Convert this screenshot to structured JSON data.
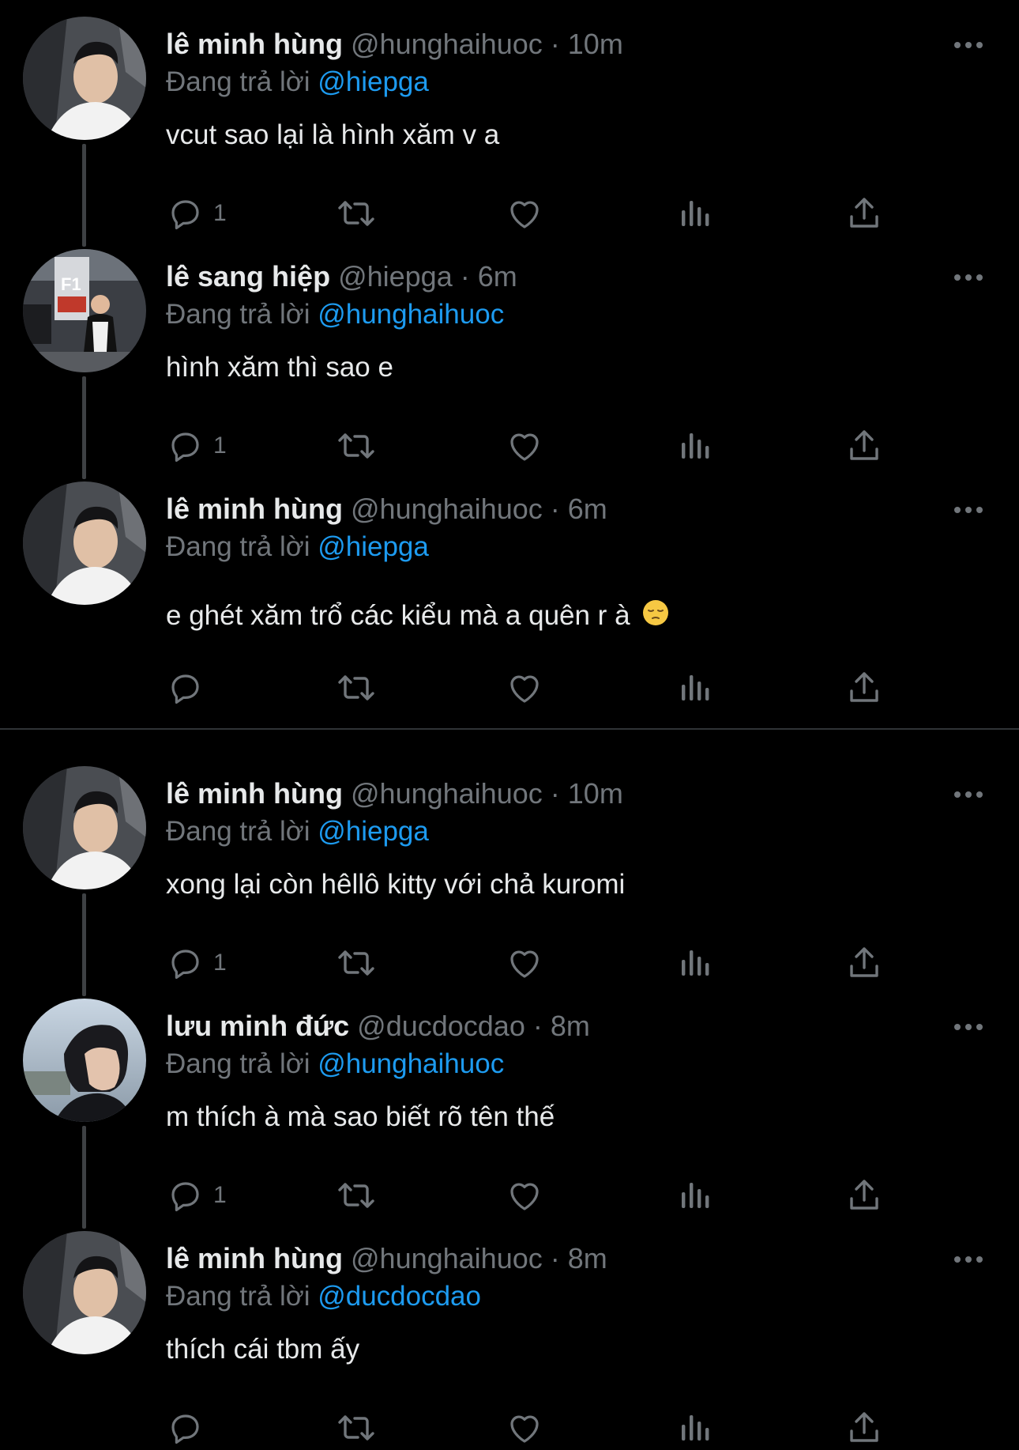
{
  "colors": {
    "background": "#000000",
    "text_primary": "#e7e9ea",
    "text_secondary": "#71767b",
    "accent": "#1d9bf0",
    "divider": "#2f3336"
  },
  "tweets": [
    {
      "name": "lê minh hùng",
      "handle": "@hunghaihuoc",
      "dot": "·",
      "time": "10m",
      "reply_prefix": "Đang trả lời",
      "reply_to": "@hiepga",
      "text": "vcut sao lại là hình xăm v a",
      "reply_count": "1",
      "avatar": "person-in-car"
    },
    {
      "name": "lê sang hiệp",
      "handle": "@hiepga",
      "dot": "·",
      "time": "6m",
      "reply_prefix": "Đang trả lời",
      "reply_to": "@hunghaihuoc",
      "text": "hình xăm thì sao e",
      "reply_count": "1",
      "avatar": "person-in-parking-garage",
      "avatar_sign": "F1"
    },
    {
      "name": "lê minh hùng",
      "handle": "@hunghaihuoc",
      "dot": "·",
      "time": "6m",
      "reply_prefix": "Đang trả lời",
      "reply_to": "@hiepga",
      "text": "e ghét xăm trổ các kiểu mà a quên r à",
      "emoji": "pensive-face-emoji",
      "reply_count": "",
      "avatar": "person-in-car"
    },
    {
      "name": "lê minh hùng",
      "handle": "@hunghaihuoc",
      "dot": "·",
      "time": "10m",
      "reply_prefix": "Đang trả lời",
      "reply_to": "@hiepga",
      "text": "xong lại còn hêllô kitty với chả kuromi",
      "reply_count": "1",
      "avatar": "person-in-car"
    },
    {
      "name": "lưu minh đức",
      "handle": "@ducdocdao",
      "dot": "·",
      "time": "8m",
      "reply_prefix": "Đang trả lời",
      "reply_to": "@hunghaihuoc",
      "text": "m thích à mà sao biết rõ tên thế",
      "reply_count": "1",
      "avatar": "person-profile-outdoors"
    },
    {
      "name": "lê minh hùng",
      "handle": "@hunghaihuoc",
      "dot": "·",
      "time": "8m",
      "reply_prefix": "Đang trả lời",
      "reply_to": "@ducdocdao",
      "text": "thích cái tbm ấy",
      "reply_count": "",
      "avatar": "person-in-car"
    }
  ],
  "action_icons": [
    "reply-icon",
    "retweet-icon",
    "like-icon",
    "views-icon",
    "share-icon"
  ],
  "more_icon": "more-options-icon"
}
